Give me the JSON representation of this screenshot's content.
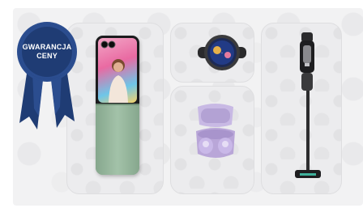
{
  "badge": {
    "line1": "GWARANCJA",
    "line2": "CENY",
    "color": "#1f3c74"
  },
  "products": [
    {
      "name": "foldable-phone",
      "icon": "phone-icon"
    },
    {
      "name": "smartwatch",
      "icon": "watch-icon"
    },
    {
      "name": "wireless-earbuds",
      "icon": "earbuds-icon"
    },
    {
      "name": "stick-vacuum",
      "icon": "vacuum-icon"
    }
  ],
  "colors": {
    "background": "#f2f2f3",
    "phone_green": "#8fae96",
    "buds_lavender": "#b9a6d8"
  }
}
